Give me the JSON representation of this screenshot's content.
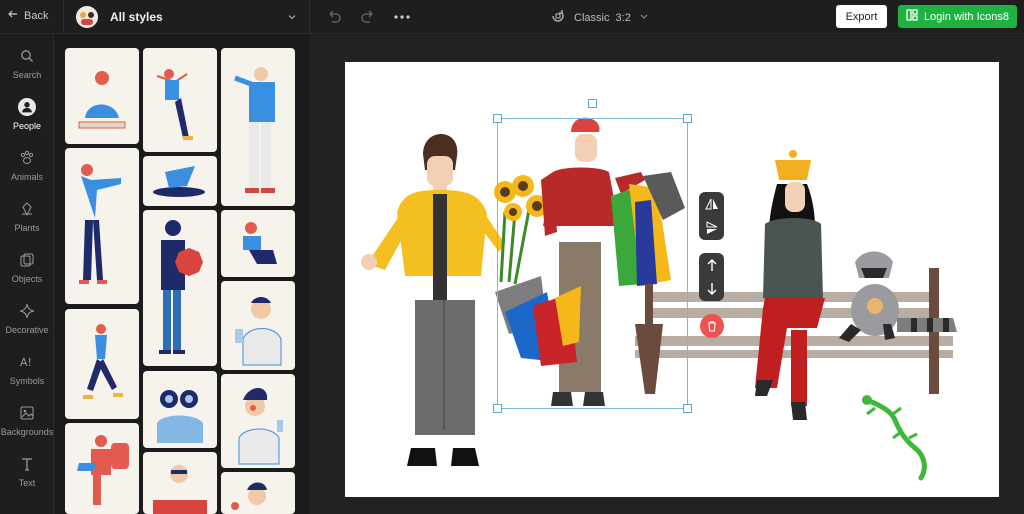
{
  "topbar": {
    "back_label": "Back",
    "styles_label": "All styles",
    "canvas_format": "Classic  3:2",
    "export_label": "Export",
    "login_label": "Login with Icons8"
  },
  "sidebar": {
    "items": [
      {
        "label": "Search",
        "icon": "search-icon"
      },
      {
        "label": "People",
        "icon": "person-icon",
        "active": true
      },
      {
        "label": "Animals",
        "icon": "paw-icon"
      },
      {
        "label": "Plants",
        "icon": "plant-icon"
      },
      {
        "label": "Objects",
        "icon": "objects-icon"
      },
      {
        "label": "Decorative",
        "icon": "sparkle-icon"
      },
      {
        "label": "Symbols",
        "icon": "symbols-icon"
      },
      {
        "label": "Backgrounds",
        "icon": "image-icon"
      },
      {
        "label": "Text",
        "icon": "text-icon"
      }
    ]
  },
  "colors": {
    "accent_green": "#1fb141",
    "delete_red": "#f0534f",
    "selection_blue": "#79b8e0",
    "card_bg": "#f6f2ec"
  }
}
